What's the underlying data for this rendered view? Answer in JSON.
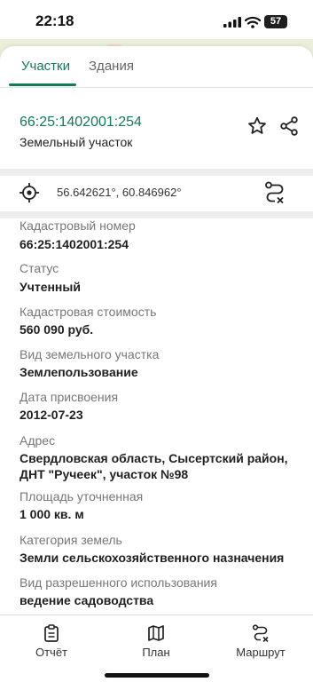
{
  "status": {
    "time": "22:18",
    "battery": "57"
  },
  "tabs": [
    {
      "label": "Участки"
    },
    {
      "label": "Здания"
    }
  ],
  "parcel": {
    "number": "66:25:1402001:254",
    "type": "Земельный участок"
  },
  "location": {
    "coords": "56.642621°, 60.846962°"
  },
  "details": [
    {
      "label": "Кадастровый номер",
      "value": "66:25:1402001:254"
    },
    {
      "label": "Статус",
      "value": "Учтенный"
    },
    {
      "label": "Кадастровая стоимость",
      "value": "560 090 руб."
    },
    {
      "label": "Вид земельного участка",
      "value": "Землепользование"
    },
    {
      "label": "Дата присвоения",
      "value": "2012-07-23"
    },
    {
      "label": "Адрес",
      "value": "Свердловская область, Сысертский район, ДНТ \"Ручеек\", участок №98"
    },
    {
      "label": "Площадь уточненная",
      "value": "1 000 кв. м"
    },
    {
      "label": "Категория земель",
      "value": "Земли сельскохозяйственного назначения"
    },
    {
      "label": "Вид разрешенного использования",
      "value": "ведение садоводства"
    }
  ],
  "bottom_nav": [
    {
      "label": "Отчёт",
      "icon": "clipboard-icon"
    },
    {
      "label": "План",
      "icon": "map-icon"
    },
    {
      "label": "Маршрут",
      "icon": "route-icon"
    }
  ],
  "colors": {
    "accent": "#0f7a5c",
    "divider": "#eeeeee"
  }
}
